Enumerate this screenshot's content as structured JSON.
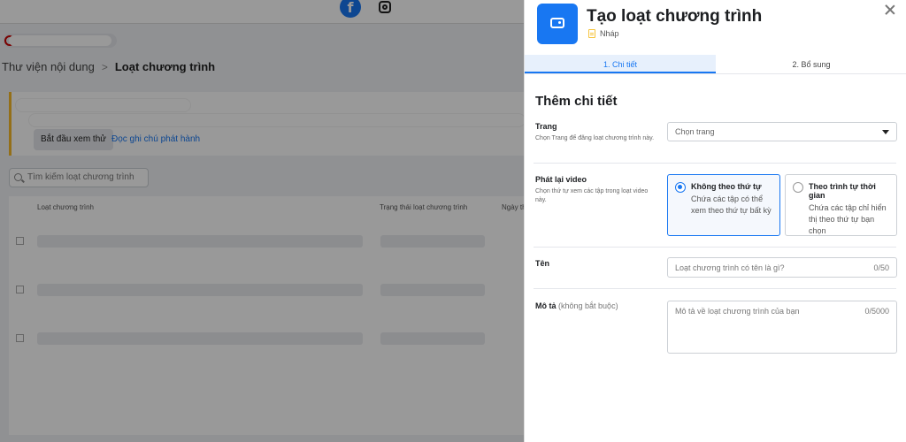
{
  "background": {
    "breadcrumb": [
      "Thư viện nội dung",
      "Loạt chương trình"
    ],
    "breadcrumb_separator": ">",
    "preview_button": "Bắt đầu xem thử",
    "release_notes_link": "Đọc ghi chú phát hành",
    "search_placeholder": "Tìm kiếm loạt chương trình",
    "table_headers": [
      "Loạt chương trình",
      "Trạng thái loạt chương trình",
      "Ngày th"
    ]
  },
  "dialog": {
    "title": "Tạo loạt chương trình",
    "status": "Nháp",
    "tabs": [
      "1. Chi tiết",
      "2. Bổ sung"
    ],
    "section_title": "Thêm chi tiết",
    "page_field": {
      "label": "Trang",
      "help": "Chọn Trang để đăng loạt chương trình này.",
      "placeholder": "Chọn trang"
    },
    "playback_field": {
      "label": "Phát lại video",
      "help": "Chọn thứ tự xem các tập trong loạt video này.",
      "options": [
        {
          "title": "Không theo thứ tự",
          "desc": "Chứa các tập có thể xem theo thứ tự bất kỳ",
          "selected": true
        },
        {
          "title": "Theo trình tự thời gian",
          "desc": "Chứa các tập chỉ hiển thị theo thứ tự bạn chọn",
          "selected": false
        }
      ]
    },
    "name_field": {
      "label": "Tên",
      "placeholder": "Loạt chương trình có tên là gì?",
      "counter": "0/50"
    },
    "description_field": {
      "label": "Mô tả",
      "optional": "(không bắt buộc)",
      "placeholder": "Mô tả về loạt chương trình của bạn",
      "counter": "0/5000"
    }
  },
  "colors": {
    "accent": "#1877f2",
    "warning": "#f7b928"
  }
}
